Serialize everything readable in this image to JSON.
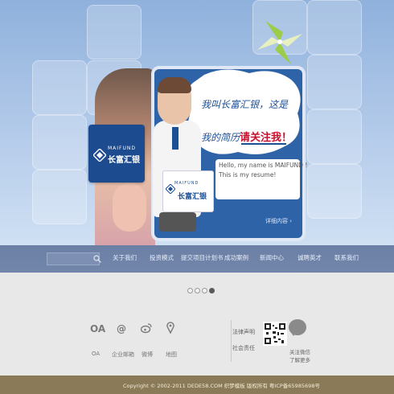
{
  "hero": {
    "logo_card": {
      "en": "MAIFUND",
      "cn": "长富汇银"
    },
    "bubble": {
      "line1": "我叫长富汇银，这是",
      "line2_plain": "我的简历",
      "line2_emph": "请关注我！"
    },
    "resume": {
      "line1": "Hello, my name is MAIFUND !",
      "line2": "This is my resume!"
    },
    "figure_sign": {
      "en": "MAIFUND",
      "cn": "长富汇银"
    },
    "detail_link": "详细内容 ›"
  },
  "nav": {
    "search_placeholder": "",
    "items": [
      "关于我们",
      "投资模式",
      "提交项目计划书",
      "成功案例",
      "新闻中心",
      "诚聘英才",
      "联系我们"
    ]
  },
  "carousel": {
    "count": 4,
    "active_index": 3
  },
  "contact": {
    "icons": [
      {
        "glyph": "OA",
        "label": "OA",
        "icon": "oa-icon"
      },
      {
        "glyph": "@",
        "label": "企业邮箱",
        "icon": "email-icon"
      },
      {
        "glyph": "微",
        "label": "微博",
        "icon": "weibo-icon"
      },
      {
        "glyph": "⚲",
        "label": "地图",
        "icon": "map-pin-icon"
      }
    ],
    "side_links": [
      "法律声明",
      "社会责任"
    ],
    "wechat_lines": [
      "关注微信",
      "了解更多"
    ]
  },
  "footer": {
    "copyright": "Copyright © 2002-2011 DEDE58.COM 织梦模板 版权所有 粤ICP备65985698号"
  },
  "colors": {
    "nav_bg": "#6c80a6",
    "brand_blue": "#1c4b8f",
    "footer_bg": "#8a7a57",
    "emphasis_red": "#c8102e"
  }
}
